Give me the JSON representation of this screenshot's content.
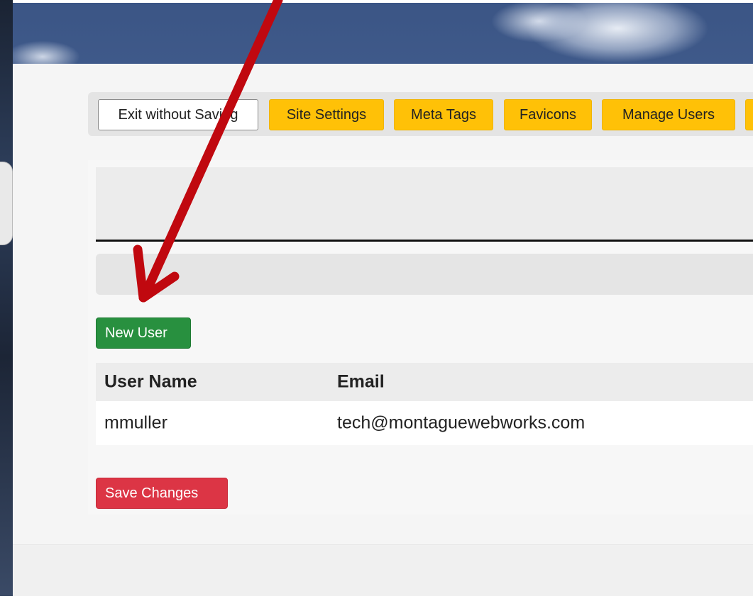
{
  "toolbar": {
    "buttons": [
      {
        "label": "Exit without Saving",
        "style": "white"
      },
      {
        "label": "Site Settings",
        "style": "yellow"
      },
      {
        "label": "Meta Tags",
        "style": "yellow"
      },
      {
        "label": "Favicons",
        "style": "yellow"
      },
      {
        "label": "Manage Users",
        "style": "yellow"
      }
    ]
  },
  "main": {
    "new_user_label": "New User",
    "save_label": "Save Changes"
  },
  "table": {
    "headers": [
      "User Name",
      "Email"
    ],
    "rows": [
      [
        "mmuller",
        "tech@montaguewebworks.com"
      ]
    ]
  },
  "colors": {
    "toolbar_button": "#ffc107",
    "new_user_button": "#28903f",
    "save_button": "#dc3545",
    "annotation_arrow": "#c0080f"
  }
}
